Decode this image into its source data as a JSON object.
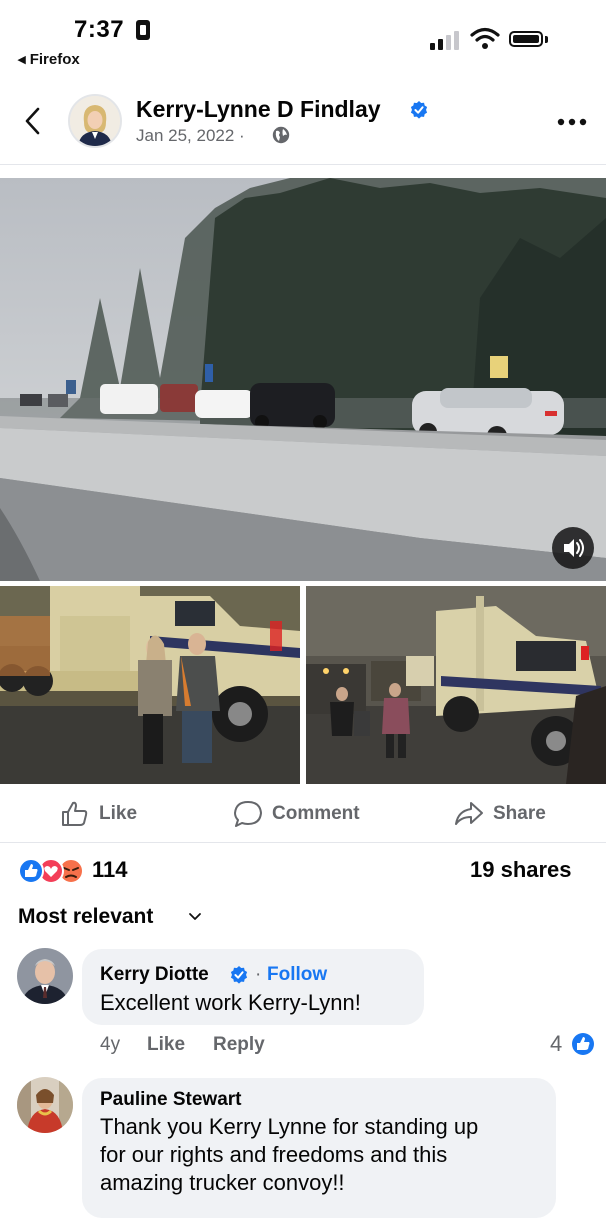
{
  "status_bar": {
    "time": "7:37",
    "back_app": "◂ Firefox"
  },
  "post": {
    "author": "Kerry-Lynne D Findlay",
    "date": "Jan 25, 2022 ·",
    "actions": {
      "like": "Like",
      "comment": "Comment",
      "share": "Share"
    },
    "reactions": {
      "icons": [
        "like-icon",
        "love-icon",
        "angry-icon"
      ],
      "count": "114",
      "shares": "19 shares"
    }
  },
  "comments_section": {
    "sort_label": "Most relevant",
    "comments": [
      {
        "author": "Kerry Diotte",
        "separator": "·",
        "follow": "Follow",
        "text": "Excellent work Kerry-Lynn!",
        "age": "4y",
        "like_label": "Like",
        "reply_label": "Reply",
        "likes": "4"
      },
      {
        "author": "Pauline Stewart",
        "text_lines": [
          "Thank you Kerry Lynne for standing up",
          "for our rights and freedoms and this",
          "amazing trucker convoy!!"
        ]
      }
    ]
  },
  "colors": {
    "brand_blue": "#1877f2",
    "meta_gray": "#65676b",
    "bubble_bg": "#f0f2f5",
    "love_red": "#f33e58",
    "angry_orange": "#f7714b"
  }
}
